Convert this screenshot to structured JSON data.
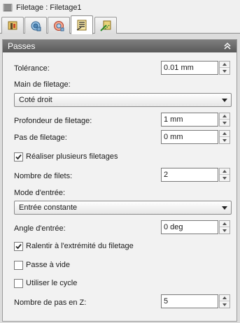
{
  "window": {
    "title": "Filetage : Filetage1"
  },
  "tabs": [
    {
      "name": "tab-tool",
      "active": false
    },
    {
      "name": "tab-holder",
      "active": false
    },
    {
      "name": "tab-geometry",
      "active": false
    },
    {
      "name": "tab-passes",
      "active": true
    },
    {
      "name": "tab-linking",
      "active": false
    }
  ],
  "section": {
    "title": "Passes",
    "collapse_icon": "double-chevron-up-icon"
  },
  "fields": {
    "tolerance": {
      "label": "Tolérance:",
      "value": "0.01 mm"
    },
    "hand": {
      "label": "Main de filetage:",
      "value": "Coté droit"
    },
    "depth": {
      "label": "Profondeur de filetage:",
      "value": "1 mm"
    },
    "pitch": {
      "label": "Pas de filetage:",
      "value": "0 mm"
    },
    "multiple": {
      "label": "Réaliser plusieurs filetages",
      "checked": true
    },
    "threads": {
      "label": "Nombre de filets:",
      "value": "2"
    },
    "infeed_mode": {
      "label": "Mode d'entrée:",
      "value": "Entrée constante"
    },
    "infeed_angle": {
      "label": "Angle d'entrée:",
      "value": "0 deg"
    },
    "slow_down": {
      "label": "Ralentir à l'extrémité du filetage",
      "checked": true
    },
    "spring_pass": {
      "label": "Passe à vide",
      "checked": false
    },
    "use_cycle": {
      "label": "Utiliser le cycle",
      "checked": false
    },
    "z_steps": {
      "label": "Nombre de pas en Z:",
      "value": "5"
    }
  },
  "colors": {
    "header": "#6c6c6c",
    "panel": "#f2f2f2",
    "background": "#dcdcdc",
    "check": "#2a2a2a"
  }
}
